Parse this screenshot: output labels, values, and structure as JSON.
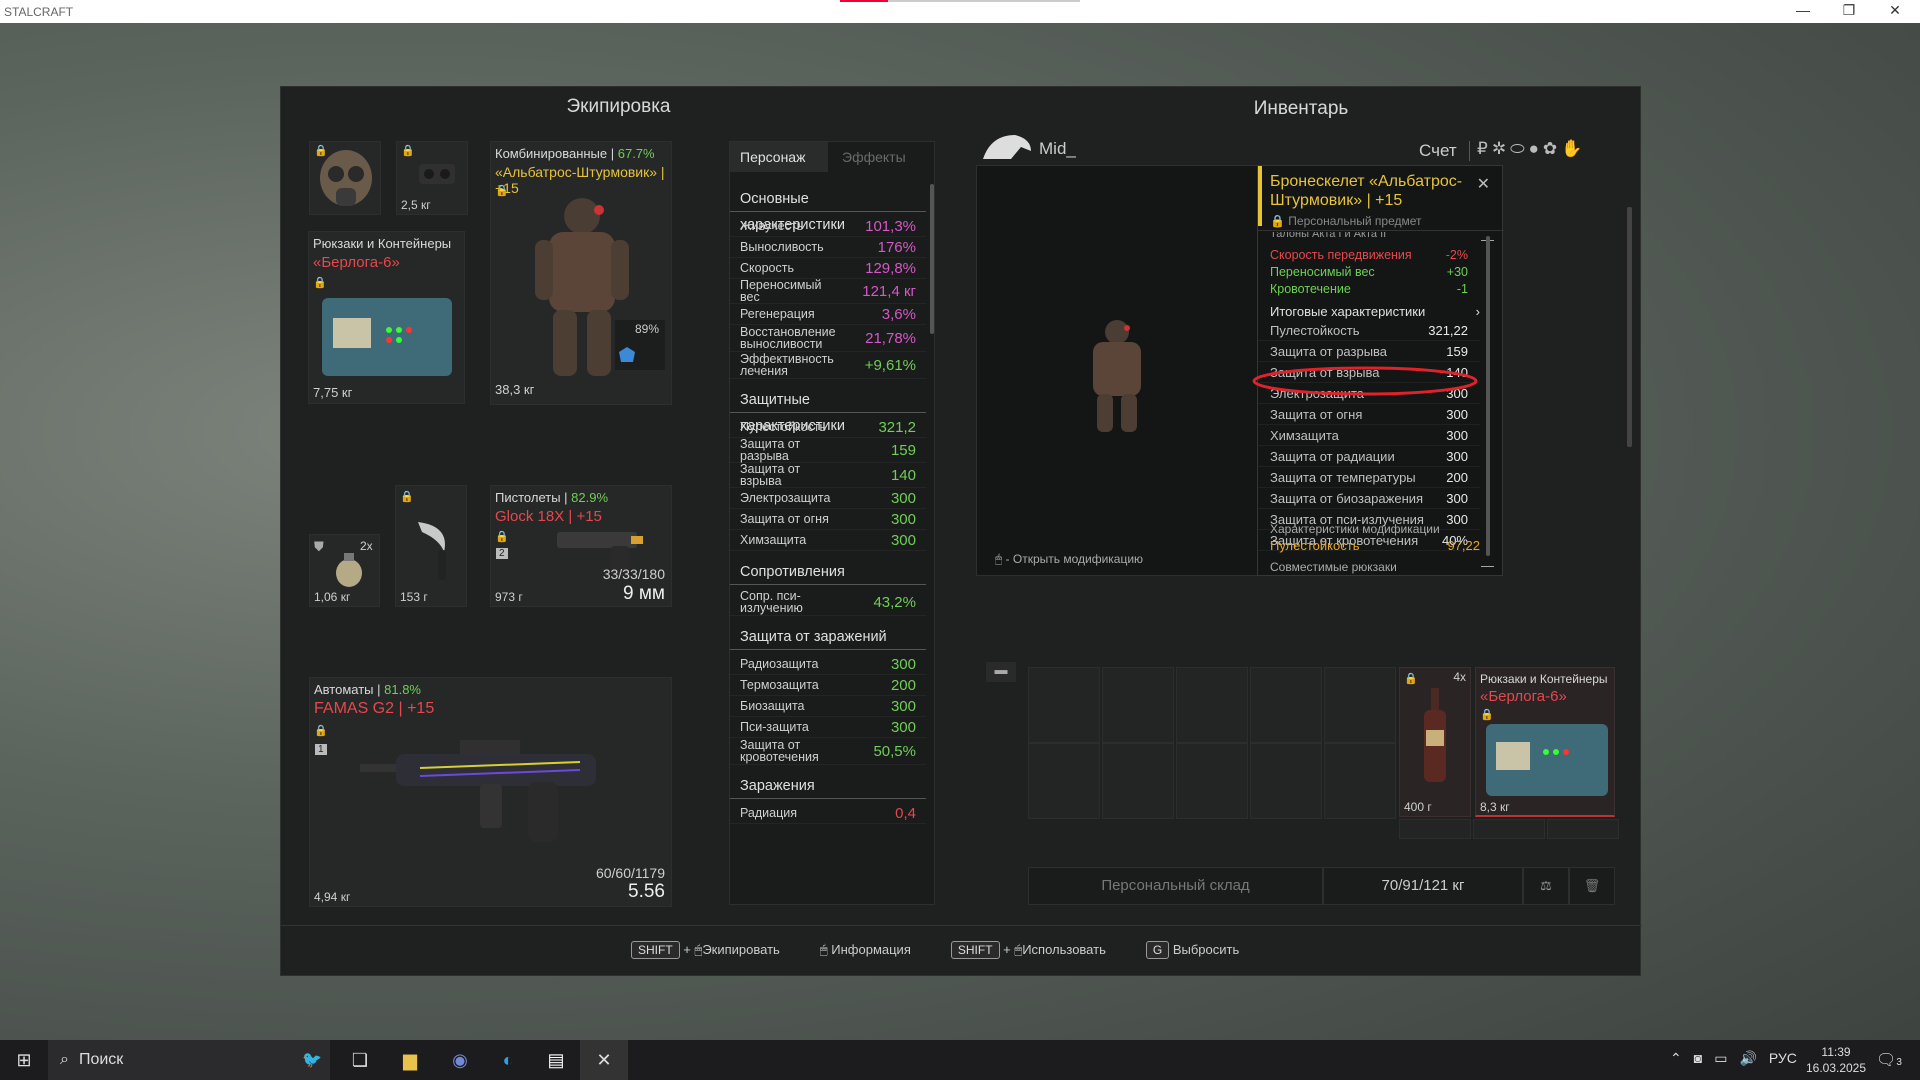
{
  "window": {
    "title": "STALCRAFT",
    "minimize": "—",
    "restore": "❐",
    "close": "✕"
  },
  "equipment": {
    "title": "Экипировка",
    "mask": {
      "icon": "gas-mask-icon"
    },
    "device": {
      "weight": "2,5 кг"
    },
    "backpack": {
      "category": "Рюкзаки и Контейнеры",
      "name": "«Берлога-6»",
      "weight": "7,75 кг"
    },
    "armor": {
      "category": "Комбинированные",
      "condition": "67.7%",
      "name": "«Альбатрос-Штурмовик»",
      "level": "+15",
      "weight": "38,3 кг",
      "extra_pct": "89%"
    },
    "grenade": {
      "count": "2x",
      "weight": "1,06 кг"
    },
    "knife": {
      "weight": "153 г"
    },
    "pistol": {
      "category": "Пистолеты",
      "condition": "82.9%",
      "name": "Glock 18X",
      "level": "+15",
      "ammo": "33/33/180",
      "caliber": "9 мм",
      "weight": "973 г",
      "slot": "2"
    },
    "rifle": {
      "category": "Автоматы",
      "condition": "81.8%",
      "name": "FAMAS G2",
      "level": "+15",
      "ammo": "60/60/1179",
      "caliber": "5.56",
      "weight": "4,94 кг",
      "slot": "1"
    }
  },
  "stats": {
    "tabs": [
      "Персонаж",
      "Эффекты"
    ],
    "basic_title": "Основные характеристики",
    "basic": [
      {
        "label": "Живучесть",
        "value": "101,3%",
        "color": "#d657c8"
      },
      {
        "label": "Выносливость",
        "value": "176%",
        "color": "#d657c8"
      },
      {
        "label": "Скорость",
        "value": "129,8%",
        "color": "#d657c8"
      },
      {
        "label": "Переносимый вес",
        "value": "121,4 кг",
        "color": "#d657c8"
      },
      {
        "label": "Регенерация",
        "value": "3,6%",
        "color": "#d657c8"
      },
      {
        "label": "Восстановление выносливости",
        "value": "21,78%",
        "color": "#d657c8"
      },
      {
        "label": "Эффективность лечения",
        "value": "+9,61%",
        "color": "#6fcf56"
      }
    ],
    "protect_title": "Защитные характеристики",
    "protect": [
      {
        "label": "Пулестойкость",
        "value": "321,2"
      },
      {
        "label": "Защита от разрыва",
        "value": "159"
      },
      {
        "label": "Защита от взрыва",
        "value": "140"
      },
      {
        "label": "Электрозащита",
        "value": "300"
      },
      {
        "label": "Защита от огня",
        "value": "300"
      },
      {
        "label": "Химзащита",
        "value": "300"
      }
    ],
    "resist_title": "Сопротивления",
    "resist": [
      {
        "label": "Сопр. пси-излучению",
        "value": "43,2%"
      }
    ],
    "infection_prot_title": "Защита от заражений",
    "infection_prot": [
      {
        "label": "Радиозащита",
        "value": "300"
      },
      {
        "label": "Термозащита",
        "value": "200"
      },
      {
        "label": "Биозащита",
        "value": "300"
      },
      {
        "label": "Пси-защита",
        "value": "300"
      },
      {
        "label": "Защита от кровотечения",
        "value": "50,5%"
      }
    ],
    "infection_title": "Заражения",
    "infection": [
      {
        "label": "Радиация",
        "value": "0,4"
      }
    ]
  },
  "inventory": {
    "title": "Инвентарь",
    "player": "Mid_",
    "account_label": "Счет",
    "currency_icons": [
      "ruble-icon",
      "gear-token-icon",
      "boot-icon",
      "ball-icon",
      "flower-icon",
      "hand-icon"
    ],
    "preview_hint": "- Открыть модификацию",
    "bottle": {
      "count": "4x",
      "weight": "400 г"
    },
    "container": {
      "category": "Рюкзаки и Контейнеры",
      "name": "«Берлога-6»",
      "weight": "8,3 кг"
    },
    "storage_label": "Персональный склад",
    "weight_summary": "70/91/121 кг"
  },
  "tooltip": {
    "title": "Бронескелет «Альбатрос-Штурмовик» | +15",
    "subtitle": "Персональный предмет",
    "cut_text": "Талоны Акта I и Акта II",
    "mods": [
      {
        "label": "Скорость передвижения",
        "value": "-2%",
        "color": "#e5484d"
      },
      {
        "label": "Переносимый вес",
        "value": "+30",
        "color": "#6fcf56"
      },
      {
        "label": "Кровотечение",
        "value": "-1",
        "color": "#6fcf56"
      }
    ],
    "summary_link": "Итоговые характеристики",
    "rows": [
      {
        "label": "Пулестойкость",
        "value": "321,22"
      },
      {
        "label": "Защита от разрыва",
        "value": "159"
      },
      {
        "label": "Защита от взрыва",
        "value": "140"
      },
      {
        "label": "Электрозащита",
        "value": "300"
      },
      {
        "label": "Защита от огня",
        "value": "300"
      },
      {
        "label": "Химзащита",
        "value": "300"
      },
      {
        "label": "Защита от радиации",
        "value": "300"
      },
      {
        "label": "Защита от температуры",
        "value": "200"
      },
      {
        "label": "Защита от биозаражения",
        "value": "300"
      },
      {
        "label": "Защита от пси-излучения",
        "value": "300"
      },
      {
        "label": "Защита от кровотечения",
        "value": "40%"
      }
    ],
    "mod_title": "Характеристики модификации",
    "mod_row": {
      "label": "Пулестойкость",
      "value": "97,22"
    },
    "compat": "Совместимые рюкзаки"
  },
  "hotkeys": [
    {
      "key": "SHIFT",
      "plus": "+",
      "label": "Экипировать"
    },
    {
      "key": "",
      "plus": "",
      "label": "Информация"
    },
    {
      "key": "SHIFT",
      "plus": "+",
      "label": "Использовать"
    },
    {
      "key": "G",
      "plus": "",
      "label": "Выбросить"
    }
  ],
  "taskbar": {
    "search": "Поиск",
    "lang": "РУС",
    "time": "11:39",
    "date": "16.03.2025",
    "notif": "3"
  }
}
